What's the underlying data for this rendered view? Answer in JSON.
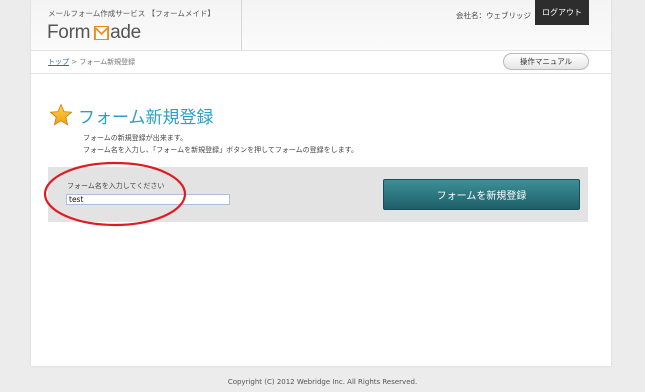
{
  "header": {
    "service_name": "メールフォーム作成サービス 【フォームメイド】",
    "logo_prefix": "Form",
    "logo_suffix": "ade",
    "company_label": "会社名：ウェブリッジ",
    "logout_label": "ログアウト"
  },
  "breadcrumb": {
    "home_link": "トップ",
    "separator": ">",
    "current": "フォーム新規登録"
  },
  "manual_button": "操作マニュアル",
  "main": {
    "title": "フォーム新規登録",
    "description_line1": "フォームの新規登録が出来ます。",
    "description_line2": "フォーム名を入力し、「フォームを新規登録」ボタンを押してフォームの登録をします。"
  },
  "form": {
    "field_label": "フォーム名を入力してください",
    "name_value": "test",
    "submit_label": "フォームを新規登録"
  },
  "footer": {
    "copyright": "Copyright (C) 2012 Webridge Inc. All Rights Reserved."
  },
  "colors": {
    "title": "#2b9fc7",
    "button": "#2a7179",
    "annotation": "#e01b24",
    "logo_accent": "#f08a1c"
  },
  "icons": {
    "title_icon": "star-icon",
    "logo_icon": "envelope-m-icon"
  }
}
